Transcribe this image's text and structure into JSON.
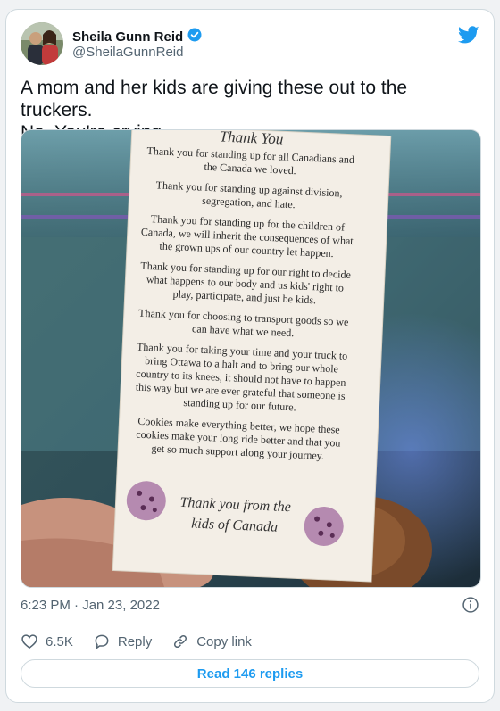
{
  "tweet": {
    "author_name": "Sheila Gunn Reid",
    "handle": "@SheilaGunnReid",
    "text_line1": "A mom and her kids are giving these out to the truckers.",
    "text_line2": "No. You're crying.",
    "timestamp": "6:23 PM · Jan 23, 2022",
    "likes": "6.5K",
    "reply_label": "Reply",
    "copy_link_label": "Copy link",
    "read_replies_label": "Read 146 replies"
  },
  "note": {
    "title": "Thank You",
    "lines": [
      "Thank you for standing up for all Canadians and",
      "the Canada we loved.",
      "Thank you for standing up against division,",
      "segregation, and hate.",
      "Thank you for standing up for the children of",
      "Canada, we will inherit the consequences of what",
      "the grown ups of our country let happen.",
      "Thank you for standing up for our right to decide",
      "what happens to our body and us kids' right to",
      "play, participate, and just be kids.",
      "Thank you for choosing to transport goods so we",
      "can have what we need.",
      "Thank you for taking your time and your truck to",
      "bring Ottawa to a halt and to bring our whole",
      "country to its knees, it should not have to happen",
      "this way but we are ever grateful that someone is",
      "standing up for our future.",
      "Cookies make everything better, we hope these",
      "cookies make your long ride better and that you",
      "get so much support along your journey."
    ],
    "signoff_line1": "Thank you from the",
    "signoff_line2": "kids of Canada"
  },
  "icons": {
    "verified": "verified-badge-icon",
    "brand": "twitter-bird-icon",
    "like": "heart-icon",
    "reply": "speech-bubble-icon",
    "copy": "link-icon",
    "info": "info-icon"
  },
  "colors": {
    "accent": "#1d9bf0",
    "secondary_text": "#536471",
    "border": "#cfd9de"
  }
}
